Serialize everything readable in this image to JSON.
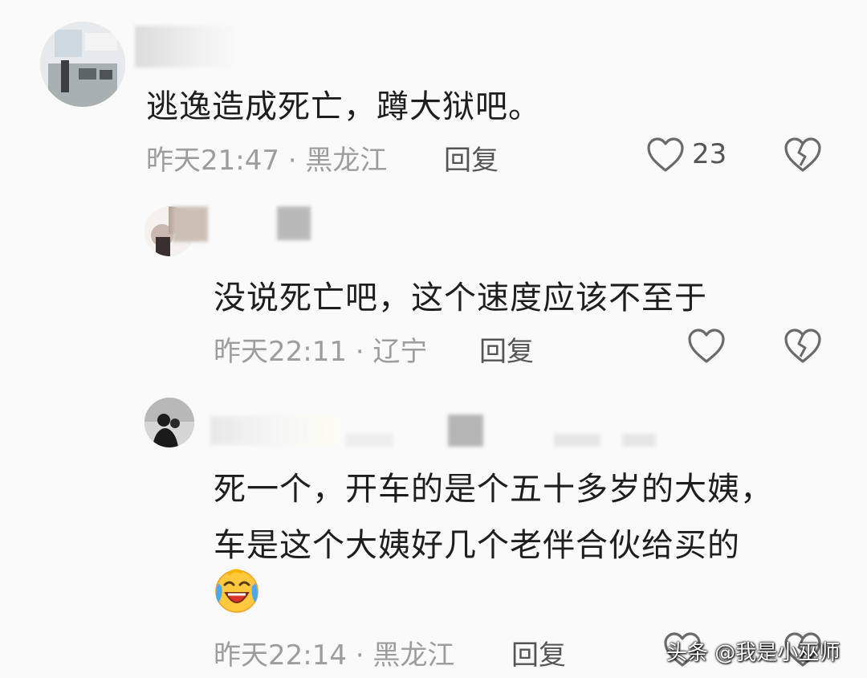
{
  "comments": [
    {
      "content": "逃逸造成死亡，蹲大狱吧。",
      "time": "昨天21:47",
      "location": "黑龙江",
      "reply_label": "回复",
      "like_count": "23"
    },
    {
      "content": "没说死亡吧，这个速度应该不至于",
      "time": "昨天22:11",
      "location": "辽宁",
      "reply_label": "回复"
    },
    {
      "content_line1": "死一个，开车的是个五十多岁的大姨，",
      "content_line2": "车是这个大姨好几个老伴合伙给买的",
      "time": "昨天22:14",
      "location": "黑龙江",
      "reply_label": "回复"
    }
  ],
  "separator": "·",
  "emoji": "laughing-crying-emoji",
  "watermark": "头条 @我是小巫师",
  "colors": {
    "background": "#fafafa",
    "meta": "#9d9d9d",
    "icon": "#6a6a6a"
  }
}
